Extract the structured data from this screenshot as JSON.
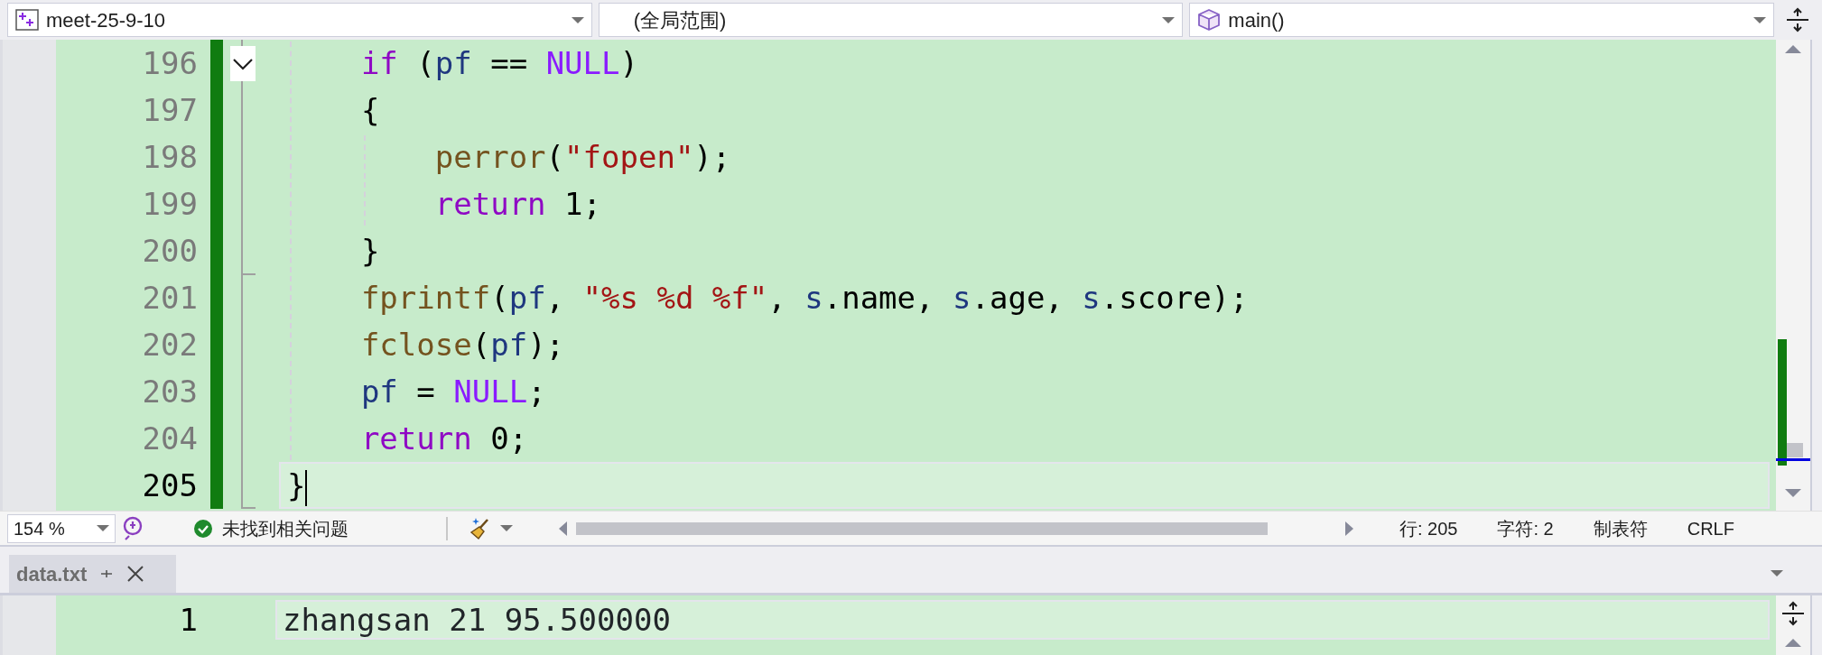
{
  "toolbar": {
    "project": "meet-25-9-10",
    "scope": "(全局范围)",
    "member": "main()"
  },
  "editor": {
    "lines": [
      {
        "number": "196",
        "current": false,
        "changed": true,
        "tokens": [
          {
            "kind": "keyword",
            "text": "    if"
          },
          {
            "kind": "plain",
            "text": " ("
          },
          {
            "kind": "variable",
            "text": "pf"
          },
          {
            "kind": "plain",
            "text": " == "
          },
          {
            "kind": "macro",
            "text": "NULL"
          },
          {
            "kind": "plain",
            "text": ")"
          }
        ]
      },
      {
        "number": "197",
        "current": false,
        "changed": true,
        "tokens": [
          {
            "kind": "plain",
            "text": "    {"
          }
        ]
      },
      {
        "number": "198",
        "current": false,
        "changed": true,
        "tokens": [
          {
            "kind": "function",
            "text": "        perror"
          },
          {
            "kind": "plain",
            "text": "("
          },
          {
            "kind": "string",
            "text": "\"fopen\""
          },
          {
            "kind": "plain",
            "text": ");"
          }
        ]
      },
      {
        "number": "199",
        "current": false,
        "changed": true,
        "tokens": [
          {
            "kind": "keyword",
            "text": "        return"
          },
          {
            "kind": "plain",
            "text": " 1;"
          }
        ]
      },
      {
        "number": "200",
        "current": false,
        "changed": true,
        "tokens": [
          {
            "kind": "plain",
            "text": "    }"
          }
        ]
      },
      {
        "number": "201",
        "current": false,
        "changed": true,
        "tokens": [
          {
            "kind": "function",
            "text": "    fprintf"
          },
          {
            "kind": "plain",
            "text": "("
          },
          {
            "kind": "variable",
            "text": "pf"
          },
          {
            "kind": "plain",
            "text": ", "
          },
          {
            "kind": "string",
            "text": "\"%s %d %f\""
          },
          {
            "kind": "plain",
            "text": ", "
          },
          {
            "kind": "variable",
            "text": "s"
          },
          {
            "kind": "plain",
            "text": ".name, "
          },
          {
            "kind": "variable",
            "text": "s"
          },
          {
            "kind": "plain",
            "text": ".age, "
          },
          {
            "kind": "variable",
            "text": "s"
          },
          {
            "kind": "plain",
            "text": ".score);"
          }
        ]
      },
      {
        "number": "202",
        "current": false,
        "changed": true,
        "tokens": [
          {
            "kind": "function",
            "text": "    fclose"
          },
          {
            "kind": "plain",
            "text": "("
          },
          {
            "kind": "variable",
            "text": "pf"
          },
          {
            "kind": "plain",
            "text": ");"
          }
        ]
      },
      {
        "number": "203",
        "current": false,
        "changed": true,
        "tokens": [
          {
            "kind": "variable",
            "text": "    pf"
          },
          {
            "kind": "plain",
            "text": " = "
          },
          {
            "kind": "macro",
            "text": "NULL"
          },
          {
            "kind": "plain",
            "text": ";"
          }
        ]
      },
      {
        "number": "204",
        "current": false,
        "changed": true,
        "tokens": [
          {
            "kind": "keyword",
            "text": "    return"
          },
          {
            "kind": "plain",
            "text": " 0;"
          }
        ]
      },
      {
        "number": "205",
        "current": true,
        "changed": true,
        "tokens": [
          {
            "kind": "plain",
            "text": "}"
          }
        ]
      }
    ]
  },
  "status_bar": {
    "zoom": "154 %",
    "issues": "未找到相关问题",
    "line": "行: 205",
    "char": "字符: 2",
    "indent": "制表符",
    "eol": "CRLF"
  },
  "panel": {
    "tabs": [
      {
        "label": "data.txt",
        "selected": true
      }
    ],
    "lines": [
      {
        "number": "1",
        "current": true,
        "text": "zhangsan 21 95.500000"
      }
    ]
  }
}
